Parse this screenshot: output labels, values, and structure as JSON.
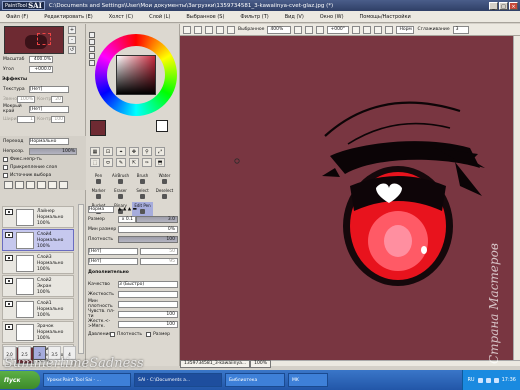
{
  "window": {
    "app_badge": "PaintTool",
    "app_name": "SAI",
    "title": "C:\\Documents and Settings\\User\\Мои документы\\Загрузки\\1359734581_3-kawaiinya-cvet-glaz.jpg (*)",
    "min": "_",
    "max": "□",
    "close": "×"
  },
  "menu": [
    "Файл (F)",
    "Редактировать (E)",
    "Холст (C)",
    "Слой (L)",
    "Выбранное (S)",
    "Фильтр (T)",
    "Вид (V)",
    "Окно (W)",
    "Помощь/Настройки"
  ],
  "navigator": {
    "zoom_label": "Масштаб",
    "zoom_value": "400.0%",
    "angle_label": "Угол",
    "angle_value": "+000.0",
    "effects_label": "Эффекты",
    "texture_label": "Текстура",
    "texture_value": "[Нет]",
    "scale_label": "Звено",
    "scale_value": "100%",
    "contrast_label": "Контр.",
    "contrast_value": "20",
    "edge_label": "Мокрый край",
    "edge_value": "[Нет]",
    "width_label": "Ширина",
    "width_value": "1",
    "strength_label": "Контр.",
    "strength_value": "100"
  },
  "layer_props": {
    "blend_label": "Переход",
    "blend_value": "Нормально",
    "opacity_label": "Непрозр.",
    "opacity_value": "100%",
    "checks": [
      "Фикс.непр-ть",
      "Прикрепление слоя",
      "Источник выбора"
    ]
  },
  "layers": [
    {
      "name": "Лайнер",
      "mode": "Нормально",
      "opacity": "100%",
      "dark": false
    },
    {
      "name": "Слой4",
      "mode": "Нормально",
      "opacity": "100%",
      "dark": false
    },
    {
      "name": "Слой3",
      "mode": "Нормально",
      "opacity": "100%",
      "dark": false
    },
    {
      "name": "Слой2",
      "mode": "Экран",
      "opacity": "100%",
      "dark": false
    },
    {
      "name": "Слой1",
      "mode": "Нормально",
      "opacity": "100%",
      "dark": false
    },
    {
      "name": "Зрачок",
      "mode": "Нормально",
      "opacity": "100%",
      "dark": false
    },
    {
      "name": "Заливка",
      "mode": "Нормально",
      "opacity": "100%",
      "dark": true
    }
  ],
  "tools": {
    "icons": [
      "▦",
      "⊡",
      "⌖",
      "✥",
      "⚲",
      "⤢",
      "⬚",
      "⬭",
      "✎",
      "⇱",
      "✑",
      "⬒"
    ],
    "brushes": [
      [
        "Pen",
        "AirBrush",
        "Brush",
        "Water"
      ],
      [
        "Marker",
        "Eraser",
        "Select",
        "Deselect"
      ],
      [
        "Bucket",
        "Binary",
        "Edit Pen",
        ""
      ]
    ],
    "mode_value": "Норма",
    "size_label": "Размер",
    "size_mult": "x 0.1",
    "size_value": "3.0",
    "min_size_label": "Мин размер",
    "min_size_value": "0%",
    "density_label": "Плотность",
    "density_value": "100",
    "shape1": "[Нет]",
    "shape2": "[Нет]",
    "shape_val1": "50",
    "shape_val2": "95",
    "extra_label": "Дополнительно",
    "quality_label": "Качество",
    "quality_value": "3 (Быстро)",
    "hardness_label": "Жесткость",
    "min_density_label": "Мин плотность",
    "sens_label": "Чувств. пл-ти",
    "sens_value": "100",
    "pressure_label": "Жестк.<->Мягк.",
    "pressure_value": "100",
    "press_label": "Давление:",
    "press_checks": [
      "Плотность",
      "Размер"
    ],
    "sizes": [
      "2.0",
      "2.5",
      "3",
      "3.5",
      "4"
    ]
  },
  "canvas_toolbar": {
    "selection_label": "Выбранное",
    "zoom": "400%",
    "angle": "+000°",
    "mode": "Норм",
    "smooth_label": "Сглаживание",
    "smooth_value": "3"
  },
  "colors": {
    "canvas_bg": "#793641",
    "iris": "#e8131d",
    "accent_select": "#a6acdc"
  },
  "doc_tab": "1359734581_3-kawaiinya...",
  "doc_tab_zoom": "100%",
  "taskbar": {
    "start": "Пуск",
    "items": [
      "Уроки:Paint Tool Sai - ...",
      "SAI - C:\\Documents a...",
      "Библиотека",
      "MK"
    ],
    "lang": "RU",
    "time": "17:36"
  },
  "watermark_left": "SummertimeSadness",
  "watermark_right": "Страна Мастеров"
}
